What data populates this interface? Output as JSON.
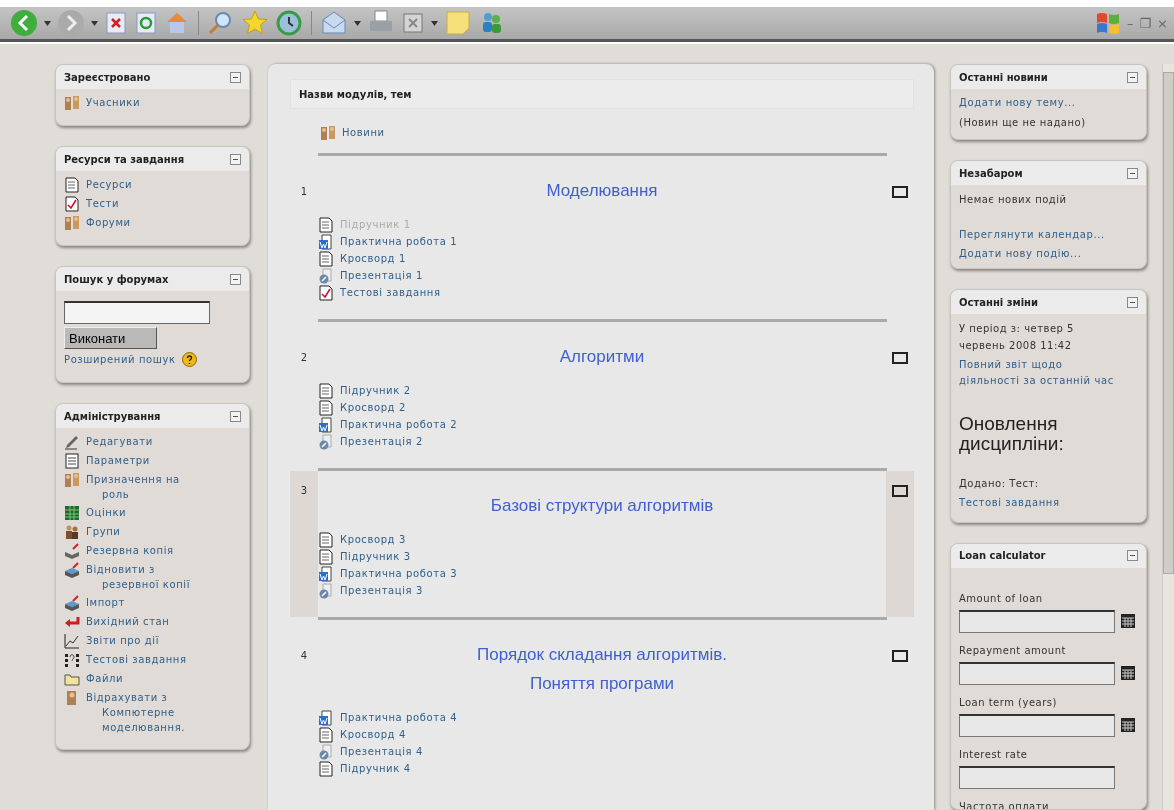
{
  "window_controls": [
    "–",
    "❐",
    "×"
  ],
  "left_blocks": [
    {
      "title": "Зареєстровано",
      "items": [
        {
          "label": "Учасники",
          "kind": "people"
        }
      ]
    },
    {
      "title": "Ресурси та завдання",
      "items": [
        {
          "label": "Ресурси",
          "kind": "doc"
        },
        {
          "label": "Тести",
          "kind": "quiz"
        },
        {
          "label": "Форуми",
          "kind": "people"
        }
      ]
    }
  ],
  "forum_search": {
    "title": "Пошук у форумах",
    "button": "Виконати",
    "advanced_link": "Розширений пошук"
  },
  "admin": {
    "title": "Адміністрування",
    "items": [
      {
        "label": "Редагувати",
        "kind": "edit"
      },
      {
        "label": "Параметри",
        "kind": "settings"
      },
      {
        "label": "Призначення на роль",
        "kind": "people"
      },
      {
        "label": "Оцінки",
        "kind": "grades"
      },
      {
        "label": "Групи",
        "kind": "group"
      },
      {
        "label": "Резервна копія",
        "kind": "backup"
      },
      {
        "label": "Відновити з резервної копії",
        "kind": "restore"
      },
      {
        "label": "Імпорт",
        "kind": "restore"
      },
      {
        "label": "Вихідний стан",
        "kind": "reset"
      },
      {
        "label": "Звіти про дії",
        "kind": "chart"
      },
      {
        "label": "Тестові завдання",
        "kind": "questions"
      },
      {
        "label": "Файли",
        "kind": "folder"
      },
      {
        "label": "Відрахувати з Компютерне моделювання.",
        "kind": "person"
      }
    ]
  },
  "course": {
    "header": "Назви модулів, тем",
    "news": {
      "label": "Новини",
      "kind": "people"
    },
    "sections": [
      {
        "number": "1",
        "current": false,
        "titles": [
          "Моделювання"
        ],
        "items": [
          {
            "label": "Підручник 1",
            "kind": "doc",
            "hidden": true
          },
          {
            "label": "Практична робота 1",
            "kind": "word",
            "hidden": false
          },
          {
            "label": "Кросворд 1",
            "kind": "doc",
            "hidden": false
          },
          {
            "label": "Презентація 1",
            "kind": "ppt",
            "hidden": false
          },
          {
            "label": "Тестові завдання",
            "kind": "quiz",
            "hidden": false
          }
        ]
      },
      {
        "number": "2",
        "current": false,
        "titles": [
          "Алгоритми"
        ],
        "items": [
          {
            "label": "Підручник 2",
            "kind": "doc",
            "hidden": false
          },
          {
            "label": "Кросворд 2",
            "kind": "doc",
            "hidden": false
          },
          {
            "label": "Практична робота 2",
            "kind": "word",
            "hidden": false
          },
          {
            "label": "Презентація 2",
            "kind": "ppt",
            "hidden": false
          }
        ]
      },
      {
        "number": "3",
        "current": true,
        "titles": [
          "Базові структури алгоритмів"
        ],
        "items": [
          {
            "label": "Кросворд 3",
            "kind": "doc",
            "hidden": false
          },
          {
            "label": "Підручник 3",
            "kind": "doc",
            "hidden": false
          },
          {
            "label": "Практична робота 3",
            "kind": "word",
            "hidden": false
          },
          {
            "label": "Презентація 3",
            "kind": "ppt",
            "hidden": false
          }
        ]
      },
      {
        "number": "4",
        "current": false,
        "titles": [
          "Порядок складання алгоритмів.",
          "Поняття програми"
        ],
        "items": [
          {
            "label": "Практична робота 4",
            "kind": "word",
            "hidden": false
          },
          {
            "label": "Кросворд 4",
            "kind": "doc",
            "hidden": false
          },
          {
            "label": "Презентація 4",
            "kind": "ppt",
            "hidden": false
          },
          {
            "label": "Підручник 4",
            "kind": "doc",
            "hidden": false
          }
        ]
      }
    ]
  },
  "latest_news": {
    "title": "Останні новини",
    "link": "Додати нову тему...",
    "note": "(Новин ще не надано)"
  },
  "upcoming": {
    "title": "Незабаром",
    "note": "Немає нових подій",
    "links": [
      "Переглянути календар...",
      "Додати нову подію..."
    ]
  },
  "recent": {
    "title": "Останні зміни",
    "since": "У період з: четвер 5 червень 2008 11:42",
    "report_link": "Повний звіт щодо діяльності за останній час",
    "heading": "Оновлення дисципліни:",
    "added": "Додано: Тест:",
    "added_link": "Тестові завдання"
  },
  "loan": {
    "title": "Loan calculator",
    "fields": [
      {
        "label": "Amount of loan",
        "kind": "calc"
      },
      {
        "label": "Repayment amount",
        "kind": "calc"
      },
      {
        "label": "Loan term (years)",
        "kind": "calc"
      },
      {
        "label": "Interest rate",
        "kind": "plain"
      },
      {
        "label": "Частота оплати",
        "kind": "label"
      }
    ]
  }
}
